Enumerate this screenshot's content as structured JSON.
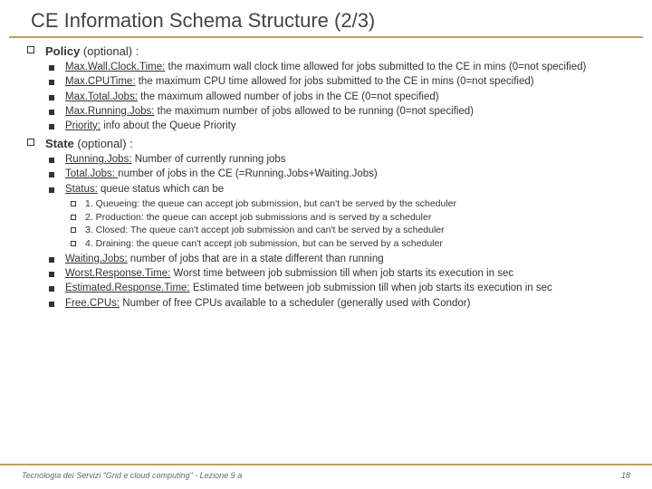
{
  "title": "CE Information Schema Structure (2/3)",
  "sections": [
    {
      "heading_bold": "Policy",
      "heading_rest": " (optional) :",
      "items": [
        {
          "u": "Max.Wall.Clock.Time:",
          "t": " the maximum wall clock time allowed for jobs submitted to the CE in mins (0=not specified)"
        },
        {
          "u": "Max.CPUTime:",
          "t": " the maximum CPU time allowed for jobs submitted to the CE in mins (0=not specified)"
        },
        {
          "u": "Max.Total.Jobs:",
          "t": " the maximum allowed number of jobs in the CE (0=not specified)"
        },
        {
          "u": "Max.Running.Jobs:",
          "t": " the maximum number of jobs allowed to be running (0=not specified)"
        },
        {
          "u": "Priority:",
          "t": " info about the Queue Priority"
        }
      ]
    },
    {
      "heading_bold": "State",
      "heading_rest": " (optional) :",
      "items": [
        {
          "u": "Running.Jobs:",
          "t": " Number of currently running jobs"
        },
        {
          "u": "Total.Jobs: ",
          "t": " number of jobs in the CE (=Running.Jobs+Waiting.Jobs)"
        },
        {
          "u": "Status:",
          "t": " queue status which can be",
          "sub": [
            "1. Queueing: the queue can accept job submission, but can't be served by the scheduler",
            "2. Production: the queue can accept job submissions and is served by a scheduler",
            "3. Closed: The queue can't accept job submission and can't be served by a scheduler",
            "4. Draining: the queue can't accept job submission, but can be served by a scheduler"
          ]
        },
        {
          "u": "Waiting.Jobs:",
          "t": " number of jobs that are in a state different than running"
        },
        {
          "u": "Worst.Response.Time:",
          "t": " Worst time between job submission till when job starts its execution in sec"
        },
        {
          "u": "Estimated.Response.Time:",
          "t": " Estimated time between job submission till when job starts its execution in sec"
        },
        {
          "u": "Free.CPUs:",
          "t": " Number of free CPUs available to a scheduler (generally used with Condor)"
        }
      ]
    }
  ],
  "footer_left": "Tecnologia dei Servizi \"Grid e cloud computing\" - Lezione 9 a",
  "footer_right": "18"
}
